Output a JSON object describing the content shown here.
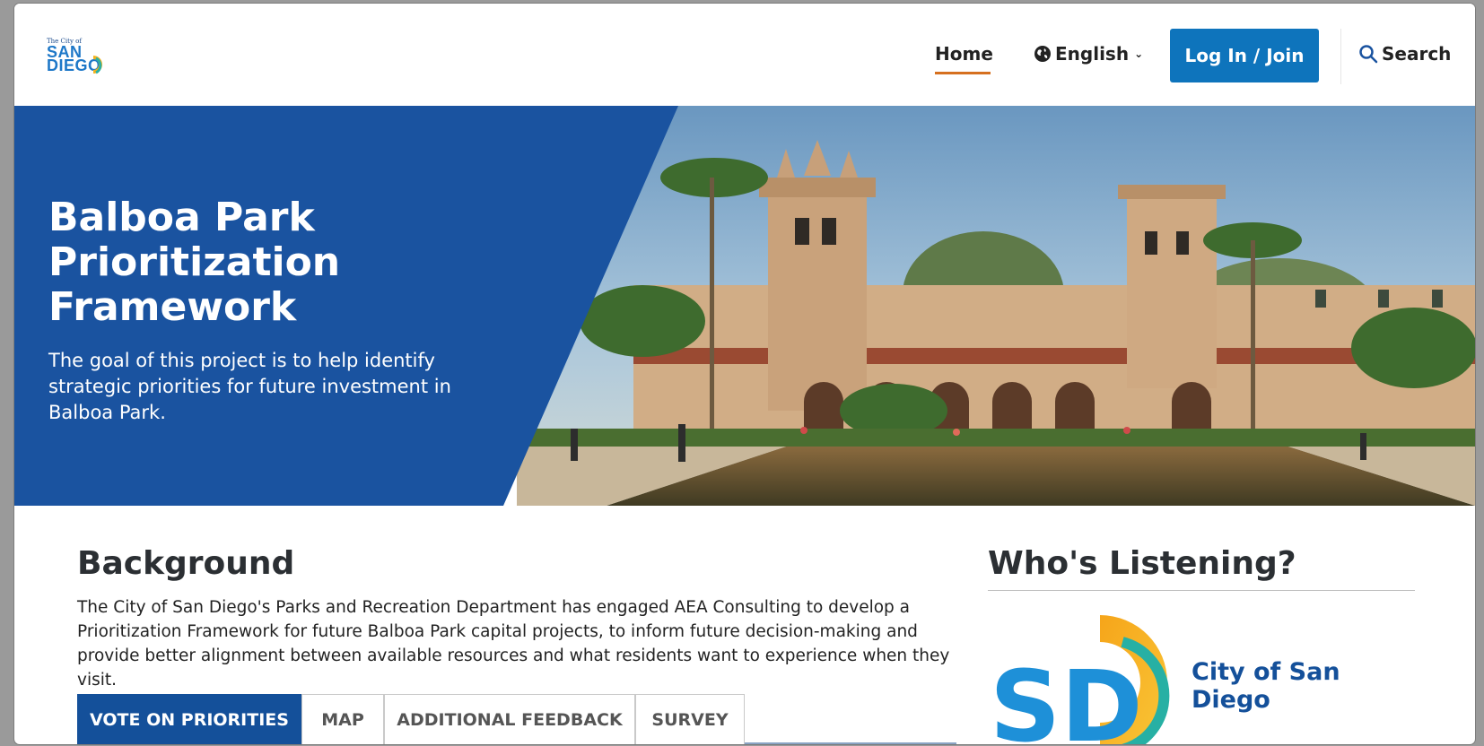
{
  "header": {
    "logo": {
      "small": "The City of",
      "line1": "SAN",
      "line2": "DIEGO"
    },
    "nav": {
      "home": "Home",
      "language": "English",
      "login": "Log In / Join",
      "search": "Search"
    },
    "colors": {
      "accent_underline": "#d6701f",
      "button": "#0e74bc"
    }
  },
  "hero": {
    "title": "Balboa Park Prioritization Framework",
    "description": "The goal of this project is to help identify strategic priorities for future investment in Balboa Park.",
    "panel_color": "#1a53a0"
  },
  "background": {
    "title": "Background",
    "text": "The City of San Diego's Parks and Recreation Department has engaged AEA Consulting to develop a Prioritization Framework for future Balboa Park capital projects, to inform future decision-making and provide better alignment between available resources and what residents want to experience when they visit."
  },
  "tabs": [
    {
      "label": "VOTE ON PRIORITIES",
      "active": true
    },
    {
      "label": "MAP",
      "active": false
    },
    {
      "label": "ADDITIONAL FEEDBACK",
      "active": false
    },
    {
      "label": "SURVEY",
      "active": false
    }
  ],
  "whos_listening": {
    "title": "Who's Listening?",
    "org_name": "City of San Diego",
    "logo_text": "SD"
  }
}
